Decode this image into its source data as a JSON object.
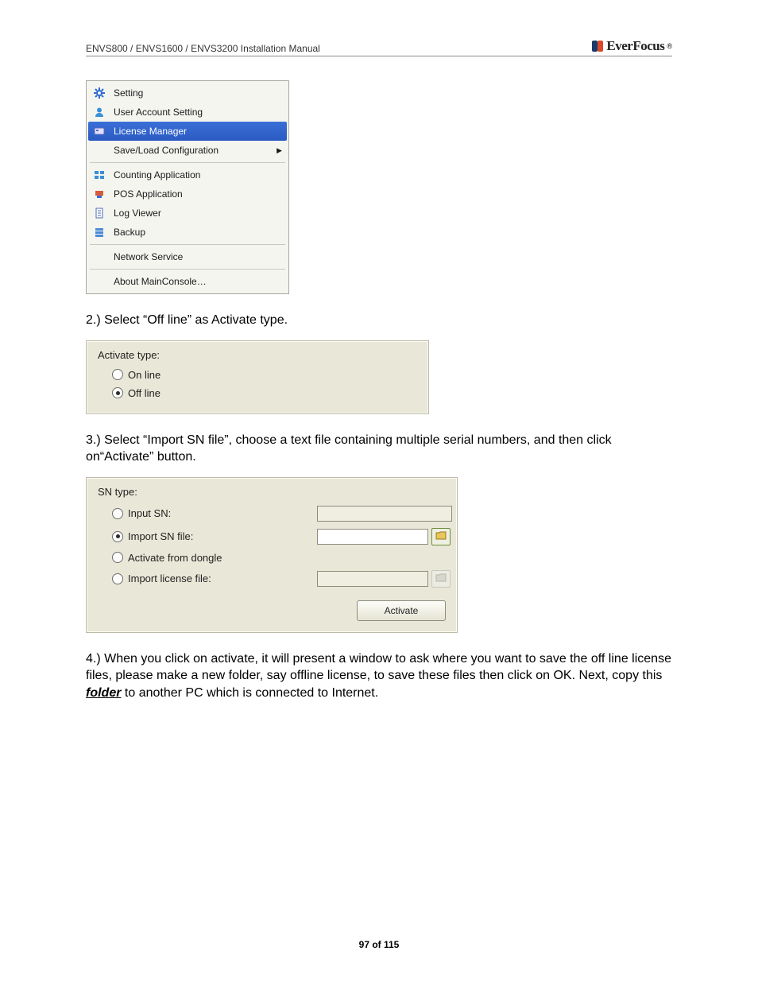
{
  "header": {
    "title": "ENVS800 / ENVS1600 / ENVS3200 Installation Manual",
    "brand": "EverFocus"
  },
  "menu": {
    "items": [
      {
        "icon": "gear-icon",
        "label": "Setting"
      },
      {
        "icon": "user-icon",
        "label": "User Account Setting"
      },
      {
        "icon": "license-icon",
        "label": "License Manager",
        "selected": true
      },
      {
        "icon": "blank-icon",
        "label": "Save/Load Configuration",
        "submenu": true
      },
      {
        "sep": true
      },
      {
        "icon": "counting-icon",
        "label": "Counting Application"
      },
      {
        "icon": "pos-icon",
        "label": "POS Application"
      },
      {
        "icon": "log-icon",
        "label": "Log Viewer"
      },
      {
        "icon": "backup-icon",
        "label": "Backup"
      },
      {
        "sep": true
      },
      {
        "icon": "blank-icon",
        "label": "Network Service"
      },
      {
        "sep": true
      },
      {
        "icon": "blank-icon",
        "label": "About MainConsole…"
      }
    ]
  },
  "step2": {
    "text": "2.) Select “Off line” as Activate type.",
    "panel": {
      "label": "Activate type:",
      "options": [
        {
          "label": "On line",
          "checked": false
        },
        {
          "label": "Off line",
          "checked": true
        }
      ]
    }
  },
  "step3": {
    "text": "3.) Select “Import SN file”, choose a text file containing multiple serial numbers, and then click on“Activate” button.",
    "panel": {
      "label": "SN type:",
      "options": [
        {
          "label": "Input SN:",
          "checked": false,
          "input": "disabled-text"
        },
        {
          "label": "Import SN file:",
          "checked": true,
          "input": "file-enabled"
        },
        {
          "label": "Activate from dongle",
          "checked": false
        },
        {
          "label": "Import license file:",
          "checked": false,
          "input": "file-disabled"
        }
      ],
      "button": "Activate"
    }
  },
  "step4": {
    "pre": "4.) When you click on activate, it will present a window to ask where you want to save the off line license files, please make a new folder, say offline license, to save these files then click on OK. Next, copy this ",
    "em": "folder",
    "post": " to another PC which is connected to Internet."
  },
  "footer": "97 of 115"
}
